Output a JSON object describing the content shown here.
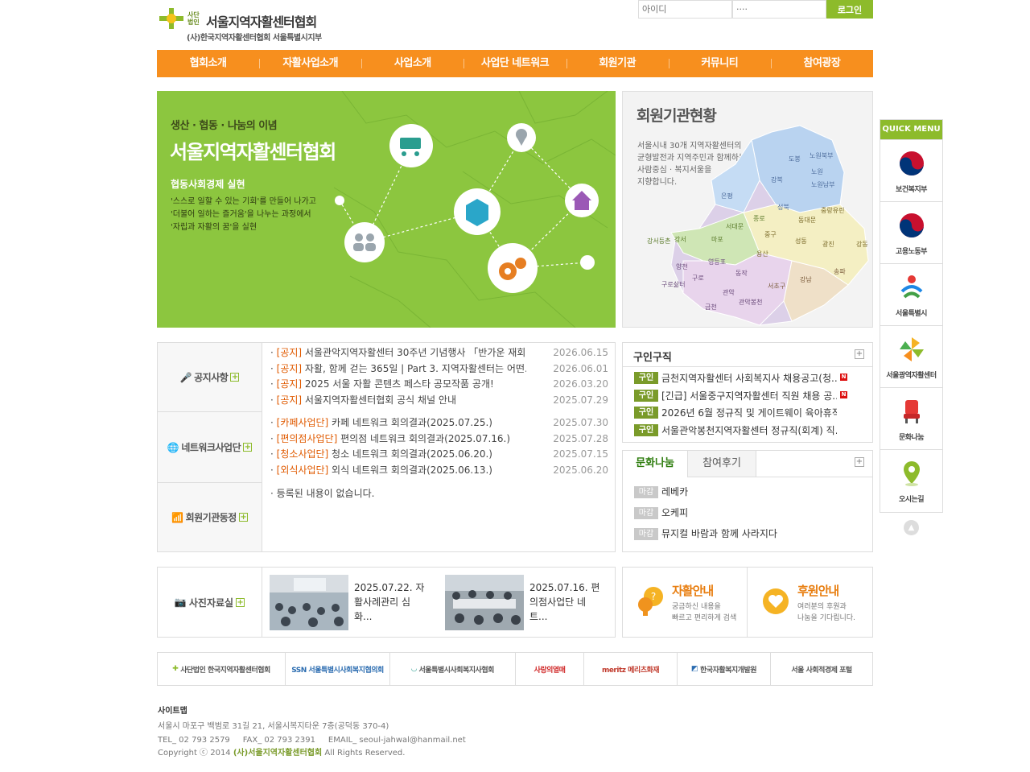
{
  "header": {
    "logo_small": "사단법인",
    "logo_name": "서울지역자활센터협회",
    "logo_sub": "(사)한국지역자활센터협회 서울특별시지부",
    "login": {
      "id_placeholder": "아이디",
      "pw_value": "····",
      "button": "로그인"
    }
  },
  "nav": [
    "협회소개",
    "자활사업소개",
    "사업소개",
    "사업단 네트워크",
    "회원기관",
    "커뮤니티",
    "참여광장"
  ],
  "banner": {
    "t1": "생산 · 협동 · 나눔의 이념",
    "t2": "서울지역자활센터협회",
    "t3": "협동사회경제 실현",
    "t4": [
      "'스스로 일할 수 있는 기회'를 만들어 나가고",
      "'더불어 일하는 즐거움'을 나누는 과정에서",
      "'자립과 자활의 꿈'을 실현"
    ]
  },
  "member_map": {
    "title": "회원기관현황",
    "desc": [
      "서울시내 30개 지역자활센터의",
      "균형발전과 지역주민과 함께하는",
      "사람중심 · 복지서울을",
      "지향합니다."
    ],
    "districts": [
      "도봉",
      "노원북부",
      "노원",
      "노원남부",
      "강북",
      "은평",
      "성북",
      "중랑유린",
      "동대문",
      "종로",
      "서대문",
      "중구",
      "성동",
      "광진",
      "강동",
      "강서등촌",
      "강서",
      "마포",
      "용산",
      "송파",
      "양천",
      "영등포",
      "동작",
      "강남",
      "구로",
      "구로삶터",
      "관악",
      "서초구",
      "금천",
      "관악봉천"
    ]
  },
  "news": {
    "categories": [
      "공지사항",
      "네트워크사업단",
      "회원기관동정"
    ],
    "notices": [
      {
        "tag": "[공지]",
        "title": "서울관악지역자활센터 30주년 기념행사 「반가운 재회...",
        "date": "2026.06.15"
      },
      {
        "tag": "[공지]",
        "title": "자활, 함께 걷는 365일 | Part 3. 지역자활센터는 어떤...",
        "date": "2026.06.01"
      },
      {
        "tag": "[공지]",
        "title": "2025 서울 자활 콘텐츠 페스타 공모작품 공개!",
        "date": "2026.03.20"
      },
      {
        "tag": "[공지]",
        "title": "서울지역자활센터협회 공식 채널 안내",
        "date": "2025.07.29"
      }
    ],
    "network": [
      {
        "tag": "[카페사업단]",
        "title": "카페 네트워크 회의결과(2025.07.25.)",
        "date": "2025.07.30"
      },
      {
        "tag": "[편의점사업단]",
        "title": "편의점 네트워크 회의결과(2025.07.16.)",
        "date": "2025.07.28"
      },
      {
        "tag": "[청소사업단]",
        "title": "청소 네트워크 회의결과(2025.06.20.)",
        "date": "2025.07.15"
      },
      {
        "tag": "[외식사업단]",
        "title": "외식 네트워크 회의결과(2025.06.13.)",
        "date": "2025.06.20"
      }
    ],
    "member_empty": "등록된 내용이 없습니다."
  },
  "recruit": {
    "title": "구인구직",
    "badge": "구인",
    "items": [
      {
        "title": "금천지역자활센터 사회복지사 채용공고(청...",
        "new": "N"
      },
      {
        "title": "[긴급] 서울중구지역자활센터 직원 채용 공...",
        "new": "N"
      },
      {
        "title": "2026년 6월 정규직 및 게이트웨이 육아휴직...",
        "new": ""
      },
      {
        "title": "서울관악봉천지역자활센터 정규직(회계) 직...",
        "new": ""
      }
    ]
  },
  "share": {
    "tabs": [
      "문화나눔",
      "참여후기"
    ],
    "badge": "마감",
    "items": [
      "레베카",
      "오케피",
      "뮤지컬 바람과 함께 사라지다"
    ]
  },
  "photo": {
    "title": "사진자료실",
    "items": [
      {
        "caption": "2025.07.22. 자활사례관리 심화..."
      },
      {
        "caption": "2025.07.16. 편의점사업단 네트..."
      }
    ]
  },
  "guide": [
    {
      "title": "자활안내",
      "desc": [
        "궁금하신 내용을",
        "빠르고 편리하게 검색"
      ]
    },
    {
      "title": "후원안내",
      "desc": [
        "여러분의 후원과",
        "나눔을 기다립니다."
      ]
    }
  ],
  "partners": [
    "사단법인 한국지역자활센터협회",
    "SSN 서울특별시사회복지협의회",
    "서울특별시사회복지사협회",
    "사랑의열매",
    "meritz 메리츠화재",
    "한국자활복지개발원",
    "서울 사회적경제 포털"
  ],
  "footer": {
    "sitemap": "사이트맵",
    "address": "서울시 마포구 백범로 31길 21, 서울시복지타운 7층(공덕동 370-4)",
    "contact": "TEL_ 02 793 2579     FAX_ 02 793 2391     EMAIL_ seoul-jahwal@hanmail.net",
    "copyright_pre": "Copyright ⓒ 2014",
    "copyright_org": "(사)서울지역자활센터협회",
    "copyright_post": "All Rights Reserved."
  },
  "quick_menu": {
    "title": "QUICK MENU",
    "items": [
      "보건복지부",
      "고용노동부",
      "서울특별시",
      "서울광역자활센터",
      "문화나눔",
      "오시는길"
    ]
  },
  "colors": {
    "orange": "#f78f1e",
    "green": "#8dbb2b",
    "banner_green": "#8cc63f"
  }
}
